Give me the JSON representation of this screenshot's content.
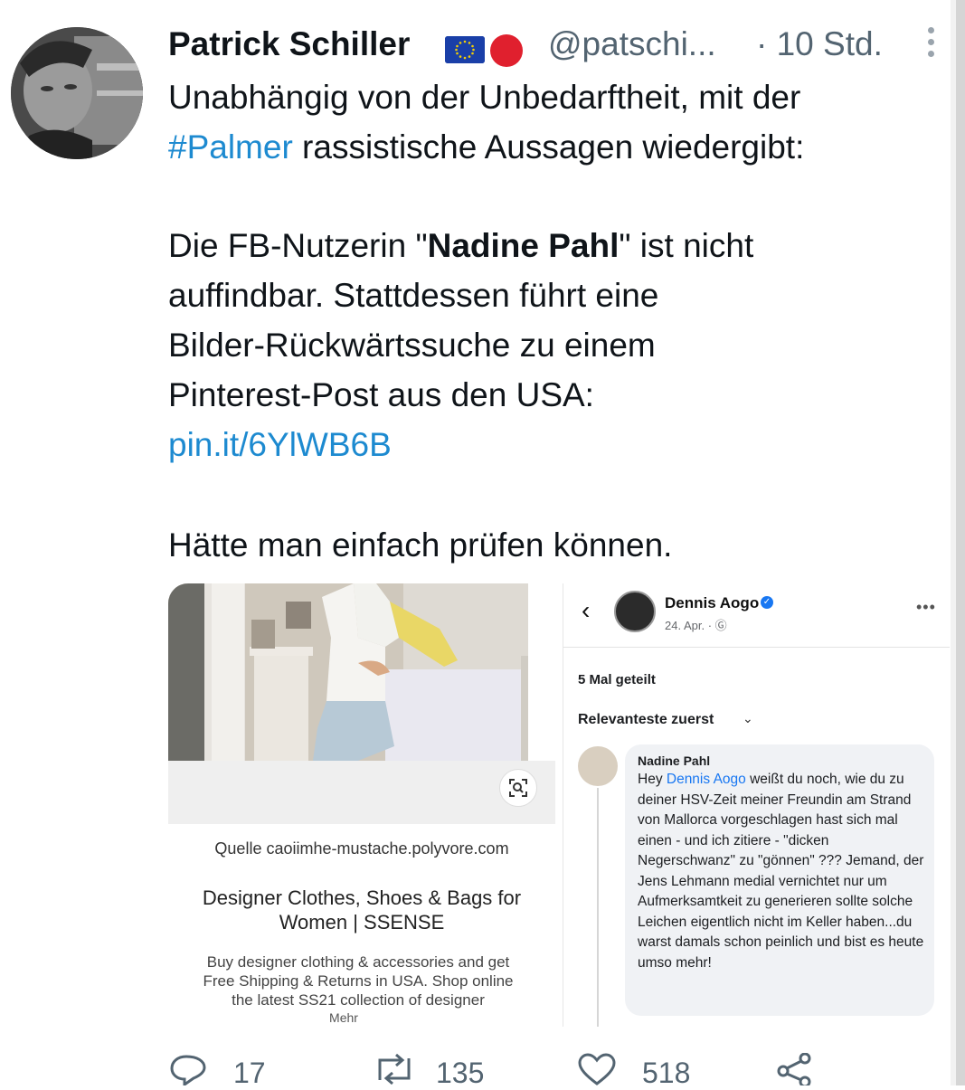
{
  "tweet": {
    "author_name": "Patrick Schiller",
    "handle": "@patschi...",
    "time": "· 10 Std.",
    "line1": "Unabhängig von der Unbedarftheit, mit der",
    "hashtag": "#Palmer",
    "line2_rest": " rassistische Aussagen wiedergibt:",
    "p2_line1_pre": "Die FB-Nutzerin \"",
    "p2_bold": "Nadine Pahl",
    "p2_line1_post": "\" ist nicht",
    "p2_line2": "auffindbar. Stattdessen führt eine",
    "p2_line3": "Bilder-Rückwärtssuche zu einem",
    "p2_line4": "Pinterest-Post aus den USA:",
    "link": "pin.it/6YlWB6B",
    "p3": "Hätte man einfach prüfen können."
  },
  "pin_card": {
    "source": "Quelle caoiimhe-mustache.polyvore.com",
    "title_line1": "Designer Clothes, Shoes & Bags for",
    "title_line2": "Women | SSENSE",
    "desc": "Buy designer clothing & accessories and get Free Shipping & Returns in USA. Shop online the latest SS21 collection of designer",
    "more": "Mehr"
  },
  "fb_card": {
    "poster": "Dennis Aogo",
    "date": "24. Apr. · Ⓖ",
    "dots": "•••",
    "shares": "5 Mal geteilt",
    "sort": "Relevanteste zuerst",
    "comment_author": "Nadine Pahl",
    "comment_pre": "Hey ",
    "comment_mention": "Dennis Aogo",
    "comment_post": "  weißt du noch, wie du zu deiner HSV-Zeit meiner Freundin am Strand von Mallorca vorgeschlagen hast sich mal einen - und ich zitiere - \"dicken Negerschwanz\" zu \"gönnen\" ??? Jemand, der Jens Lehmann medial vernichtet nur um Aufmerksamtkeit zu generieren sollte solche Leichen eigentlich nicht im Keller haben...du warst damals schon peinlich und bist es heute umso mehr!"
  },
  "actions": {
    "replies": "17",
    "retweets": "135",
    "likes": "518"
  },
  "icons": [
    "eu-flag-icon",
    "red-circle-icon",
    "more-vertical-icon",
    "back-arrow-icon",
    "verified-icon",
    "visual-search-icon",
    "reply-icon",
    "retweet-icon",
    "like-icon",
    "share-icon"
  ],
  "colors": {
    "link": "#1d8ad0",
    "secondary_text": "#536471",
    "fb_blue": "#1877f2"
  }
}
